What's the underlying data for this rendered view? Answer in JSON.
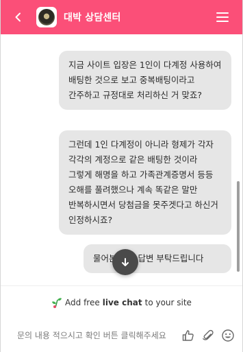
{
  "colors": {
    "accent": "#fb4f78",
    "bubble": "#e6e6e6",
    "fab": "#4a4a4a"
  },
  "header": {
    "back_icon": "chevron-left-icon",
    "title": "대박 상담센터",
    "menu_icon": "hamburger-menu-icon"
  },
  "messages": [
    {
      "text": "지금 사이트 입장은 1인이 다계정 사용하여 배팅한 것으로 보고 중복배팅이라고 간주하고 규정대로 처리하신 거 맞죠?"
    },
    {
      "text": "그런데 1인 다계정이 아니라 형제가 각자 각각의 계정으로 같은 배팅한 것이라 그렇게 해명을 하고 가족관계증명서 등등 오해를 풀려했으나 계속 똑같은 말만 반복하시면서 당첨금을 못주겟다고 하신거 인정하시죠?"
    },
    {
      "text": "물어본 것에 답변 부탁드립니다"
    }
  ],
  "scroll_down_icon": "arrow-down-icon",
  "promo": {
    "icon": "sprout-icon",
    "prefix": "Add free ",
    "strong": "live chat",
    "suffix": " to your site"
  },
  "composer": {
    "placeholder": "문의 내용 적으시고 확인 버튼 클릭해주세요",
    "icons": [
      "thumbs-up-icon",
      "paperclip-icon",
      "smiley-icon"
    ]
  }
}
